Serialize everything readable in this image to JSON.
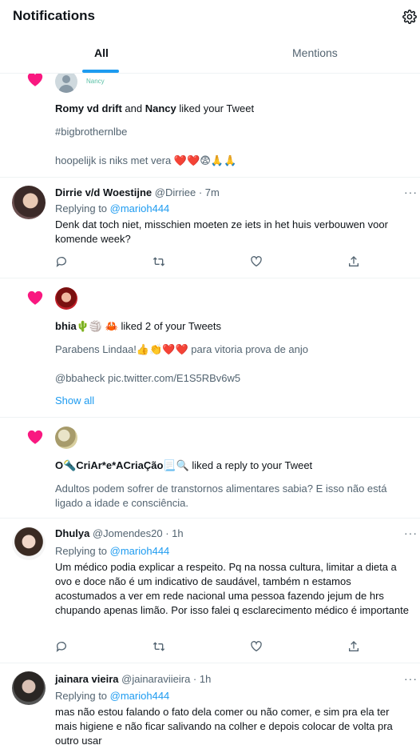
{
  "header": {
    "title": "Notifications",
    "gear_icon": "gear-icon"
  },
  "tabs": [
    {
      "label": "All"
    },
    {
      "label": "Mentions"
    }
  ],
  "items": [
    {
      "kind": "like",
      "avatar_label": "Nancy",
      "actor1": "Romy vd drift",
      "and": " and ",
      "actor2": "Nancy",
      "action": " liked your Tweet",
      "tweet_line1": "#bigbrothernlbe",
      "tweet_line2": "hoopelijk is niks met vera ❤️❤️😨🙏🙏"
    },
    {
      "kind": "reply",
      "name": "Dirrie v/d Woestijne",
      "handle": "@Dirriee · 7m",
      "replying_prefix": "Replying to ",
      "replying_to": "@marioh444",
      "text": "Denk dat toch niet, misschien moeten ze iets in het huis verbouwen voor komende week?"
    },
    {
      "kind": "like",
      "name": "bhia🌵🏐 🦀",
      "action": " liked 2 of your Tweets",
      "tweet_line1_a": "Parabens Lindaa!👍👏❤️❤️",
      "tweet_line1_b": " para vitoria prova de anjo",
      "tweet_line2": "@bbaheck pic.twitter.com/E1S5RBv6w5",
      "show_all": "Show all"
    },
    {
      "kind": "like",
      "name": "O🔦CriAr*e*ACriaÇão📃🔍",
      "action": " liked a reply to your Tweet",
      "tweet_line1": "Adultos podem sofrer de transtornos alimentares sabia? E isso não está",
      "tweet_line2": "ligado a idade e consciência."
    },
    {
      "kind": "reply",
      "name": "Dhulya",
      "handle": "@Jomendes20 · 1h",
      "replying_prefix": "Replying to ",
      "replying_to": "@marioh444",
      "text": "Um médico podia explicar a respeito. Pq na nossa cultura, limitar a dieta a ovo e doce não é um indicativo de saudável, também n estamos acostumados a ver em rede nacional uma pessoa fazendo jejum de hrs chupando apenas limão. Por isso falei q esclarecimento médico é importante"
    },
    {
      "kind": "reply",
      "name": "jainara vieira",
      "handle": "@jainaraviieira · 1h",
      "replying_prefix": "Replying to ",
      "replying_to": "@marioh444",
      "text": "mas não estou falando o fato dela comer ou não comer, e sim pra ela ter mais higiene e não ficar salivando na colher e depois colocar de volta pra outro usar"
    }
  ],
  "more_label": "···",
  "colors": {
    "accent": "#1d9bf0",
    "heart": "#f91880",
    "muted": "#536471"
  }
}
